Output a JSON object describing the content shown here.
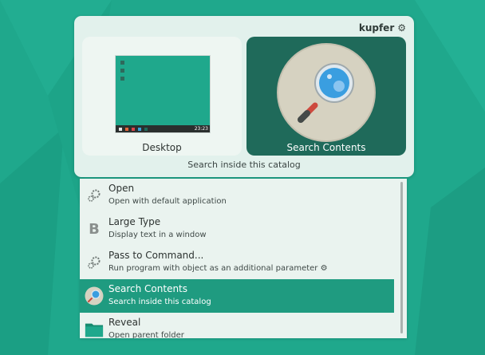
{
  "app": {
    "name": "kupfer",
    "settings_icon": "gear-icon"
  },
  "panes": {
    "object": {
      "label": "Desktop",
      "icon": "desktop-thumbnail"
    },
    "action": {
      "label": "Search Contents",
      "icon": "magnifier-icon"
    }
  },
  "selection_description": "Search inside this catalog",
  "thumbnail": {
    "clock": "23:23"
  },
  "actions": [
    {
      "title": "Open",
      "description": "Open with default application",
      "icon": "gears-icon",
      "selected": false
    },
    {
      "title": "Large Type",
      "description": "Display text in a window",
      "icon": "bold-b-icon",
      "selected": false
    },
    {
      "title": "Pass to Command...",
      "description": "Run program with object as an additional parameter ⚙",
      "icon": "gears-icon",
      "selected": false
    },
    {
      "title": "Search Contents",
      "description": "Search inside this catalog",
      "icon": "magnifier-icon",
      "selected": true
    },
    {
      "title": "Reveal",
      "description": "Open parent folder",
      "icon": "folder-icon",
      "selected": false
    }
  ],
  "colors": {
    "desktop_bg": "#1fa88c",
    "panel_bg": "#e2f1ec",
    "selected_pane": "#1f6a5a",
    "selected_row": "#1f9b80"
  }
}
